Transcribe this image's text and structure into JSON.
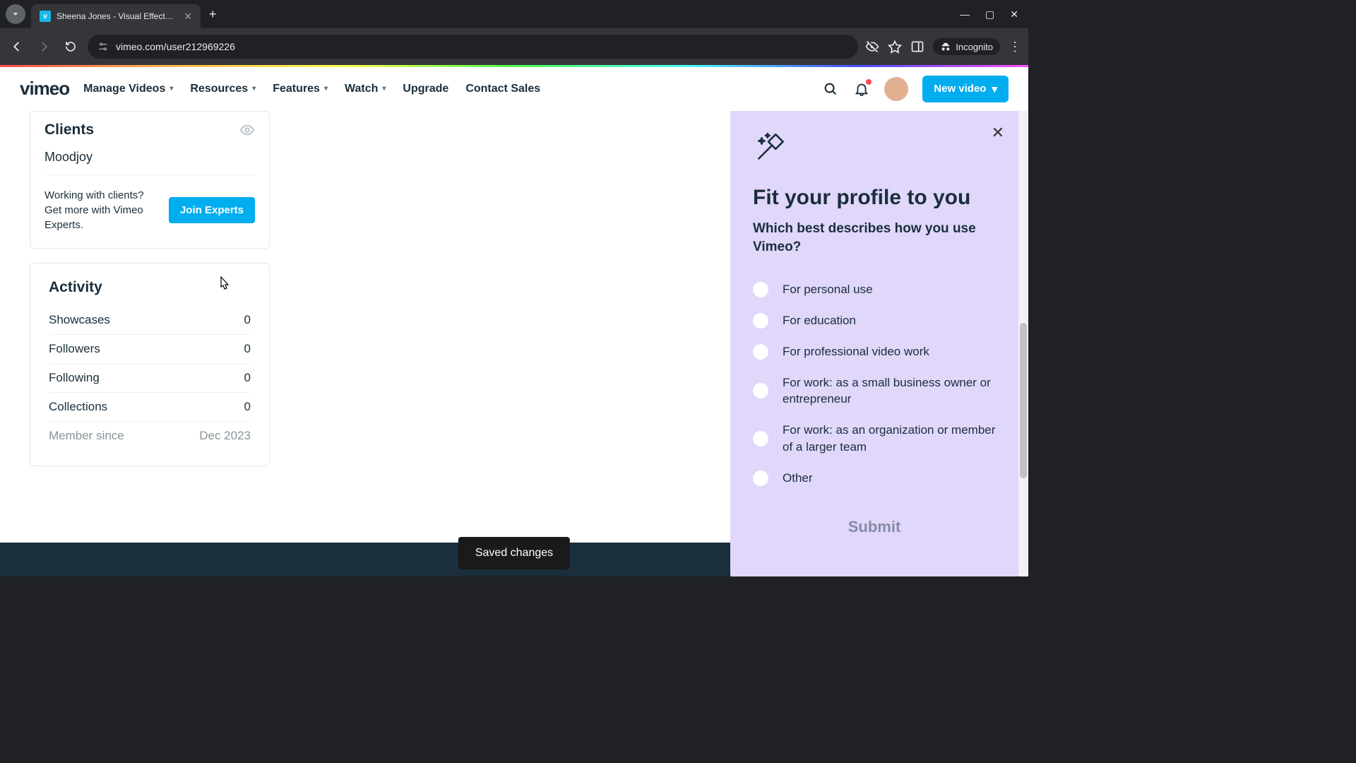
{
  "browser": {
    "tab_title": "Sheena Jones - Visual Effects P",
    "url": "vimeo.com/user212969226",
    "incognito_label": "Incognito"
  },
  "header": {
    "logo": "vimeo",
    "nav": {
      "manage": "Manage Videos",
      "resources": "Resources",
      "features": "Features",
      "watch": "Watch",
      "upgrade": "Upgrade",
      "contact": "Contact Sales"
    },
    "new_video": "New video"
  },
  "sidebar": {
    "clients": {
      "title": "Clients",
      "items": [
        "Moodjoy"
      ],
      "blurb": "Working with clients? Get more with Vimeo Experts.",
      "join_label": "Join Experts"
    },
    "activity": {
      "title": "Activity",
      "rows": [
        {
          "label": "Showcases",
          "value": "0"
        },
        {
          "label": "Followers",
          "value": "0"
        },
        {
          "label": "Following",
          "value": "0"
        },
        {
          "label": "Collections",
          "value": "0"
        }
      ],
      "member": {
        "label": "Member since",
        "value": "Dec 2023"
      }
    }
  },
  "toast": "Saved changes",
  "panel": {
    "title": "Fit your profile to you",
    "subtitle": "Which best describes how you use Vimeo?",
    "options": [
      "For personal use",
      "For education",
      "For professional video work",
      "For work: as a small business owner or entrepreneur",
      "For work: as an organization or member of a larger team",
      "Other"
    ],
    "submit": "Submit"
  }
}
